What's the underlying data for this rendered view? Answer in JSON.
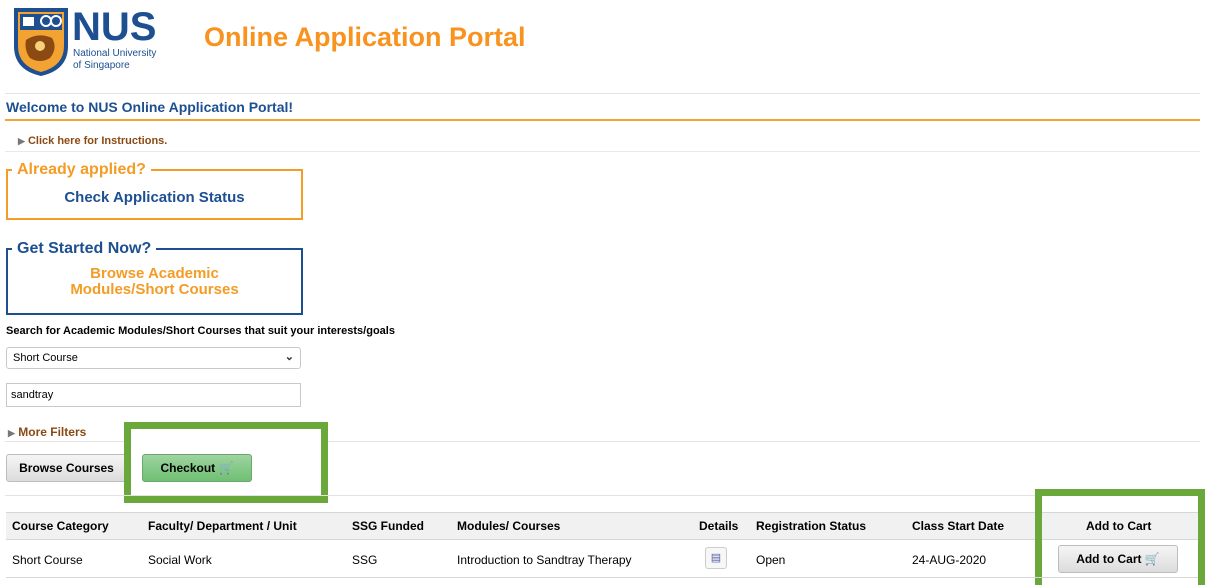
{
  "header": {
    "logo_text": "NUS",
    "logo_subtext_1": "National University",
    "logo_subtext_2": "of Singapore",
    "title": "Online Application Portal"
  },
  "welcome": "Welcome to NUS Online Application Portal!",
  "instructions_link": "Click here for Instructions.",
  "already_applied": {
    "legend": "Already applied?",
    "link": "Check Application Status"
  },
  "get_started": {
    "legend": "Get Started Now?",
    "link_line1": "Browse Academic",
    "link_line2": "Modules/Short Courses"
  },
  "search": {
    "label": "Search for Academic Modules/Short Courses that suit your interests/goals",
    "category_selected": "Short Course",
    "keyword_value": "sandtray",
    "more_filters": "More Filters"
  },
  "actions": {
    "browse_label": "Browse Courses",
    "checkout_label": "Checkout"
  },
  "table": {
    "headers": {
      "category": "Course Category",
      "faculty": "Faculty/ Department / Unit",
      "ssg": "SSG Funded",
      "module": "Modules/ Courses",
      "details": "Details",
      "status": "Registration Status",
      "start": "Class Start Date",
      "cart": "Add to Cart"
    },
    "rows": [
      {
        "category": "Short Course",
        "faculty": "Social Work",
        "ssg": "SSG",
        "module": "Introduction to Sandtray Therapy",
        "status": "Open",
        "start": "24-AUG-2020",
        "cart_label": "Add to Cart"
      }
    ]
  },
  "colors": {
    "nus_blue": "#1d4f91",
    "nus_orange": "#f39c26",
    "highlight_green": "#6aa83c"
  }
}
